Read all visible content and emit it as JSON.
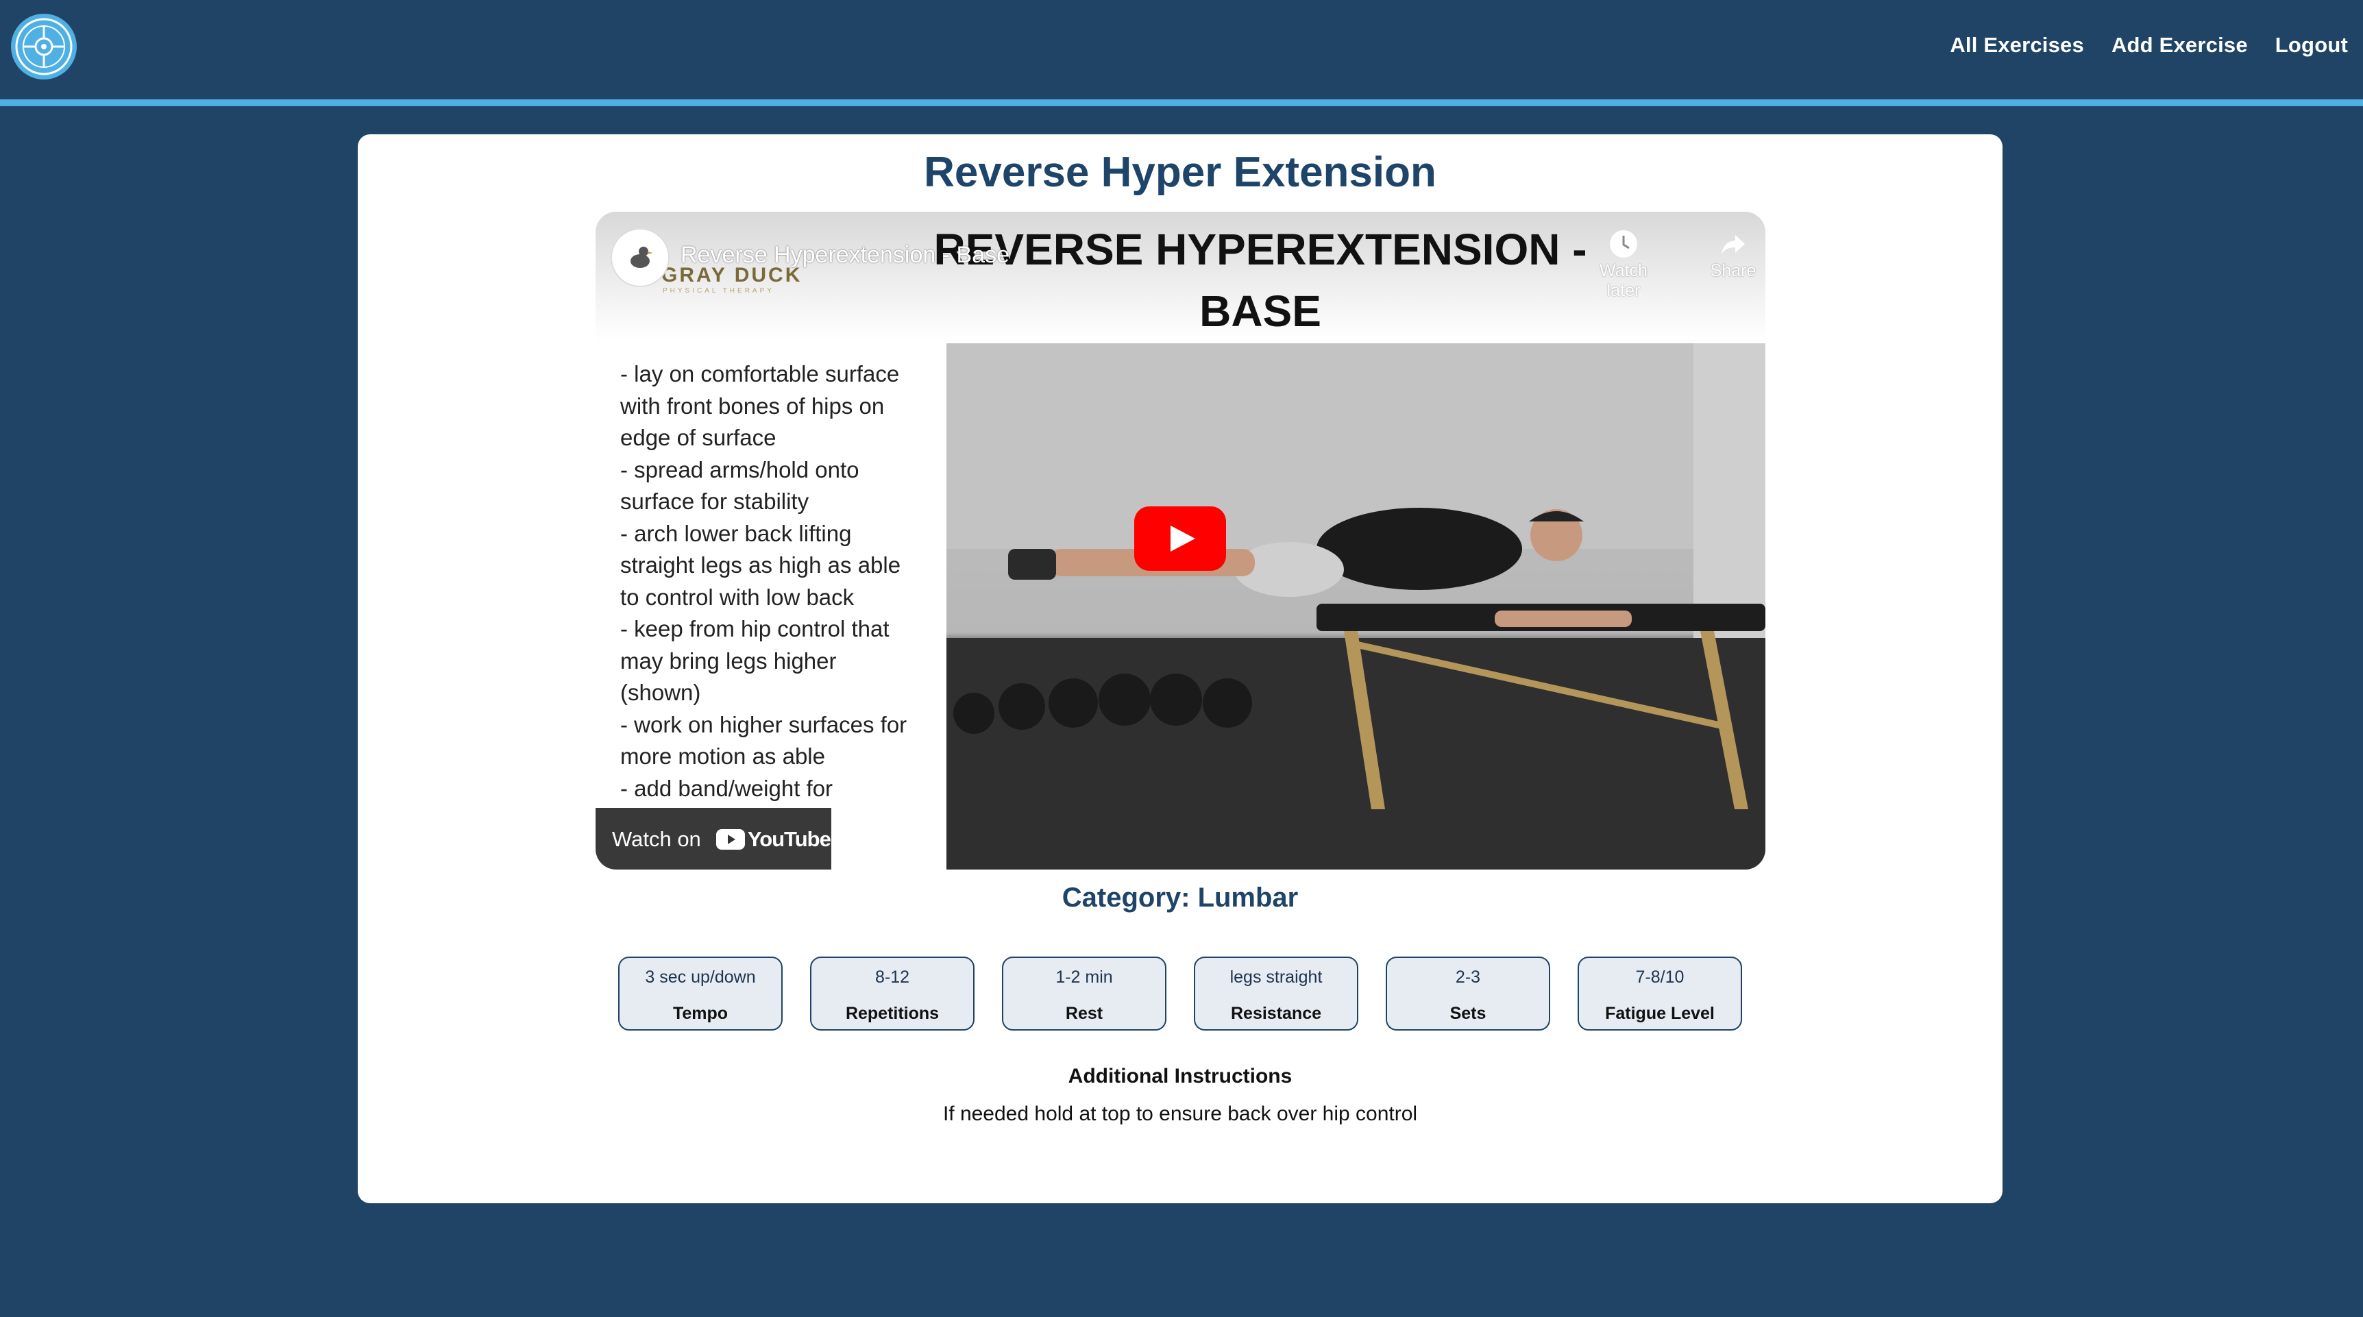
{
  "nav": {
    "links": [
      "All Exercises",
      "Add Exercise",
      "Logout"
    ]
  },
  "exercise": {
    "title": "Reverse Hyper Extension",
    "category_line": "Category: Lumbar"
  },
  "video": {
    "title": "Reverse Hyperextension - Base",
    "channel_name": "GRAY DUCK",
    "channel_subtitle": "PHYSICAL THERAPY",
    "slide_title": "REVERSE HYPEREXTENSION - BASE",
    "watch_later": "Watch later",
    "share": "Share",
    "watch_on": "Watch on",
    "youtube_wordmark": "YouTube",
    "instructions": [
      "- lay on comfortable surface",
      "with front bones of hips on",
      "edge of surface",
      "- spread arms/hold onto",
      "surface for stability",
      "- arch lower back lifting",
      "straight legs as high as able",
      "to control with low back",
      "- keep from hip control that",
      "may bring legs higher",
      "(shown)",
      "- work on higher surfaces for",
      "more motion as able",
      "- add band/weight for"
    ]
  },
  "metrics": [
    {
      "value": "3 sec up/down",
      "label": "Tempo"
    },
    {
      "value": "8-12",
      "label": "Repetitions"
    },
    {
      "value": "1-2 min",
      "label": "Rest"
    },
    {
      "value": "legs straight",
      "label": "Resistance"
    },
    {
      "value": "2-3",
      "label": "Sets"
    },
    {
      "value": "7-8/10",
      "label": "Fatigue Level"
    }
  ],
  "additional": {
    "heading": "Additional Instructions",
    "text": "If needed hold at top to ensure back over hip control"
  },
  "colors": {
    "background": "#1f4466",
    "accent_line": "#4fb0e4",
    "heading": "#1e4569",
    "youtube_red": "#ff0000"
  }
}
